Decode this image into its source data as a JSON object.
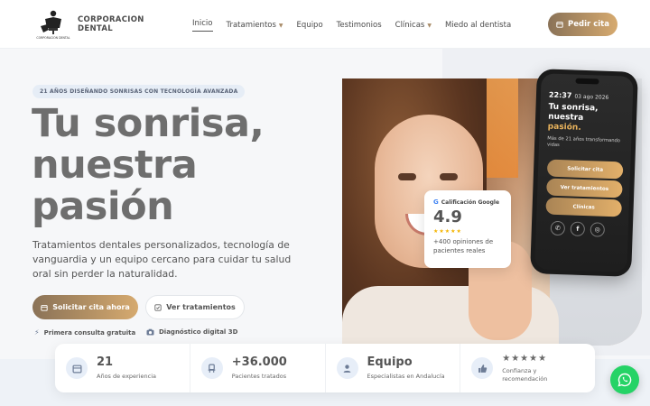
{
  "brand": {
    "logo_line1": "CORPORACION",
    "logo_line2": "DENTAL",
    "logo_tagline": "CORPORACION DENTAL"
  },
  "nav": {
    "items": [
      {
        "label": "Inicio",
        "active": true,
        "dropdown": false
      },
      {
        "label": "Tratamientos",
        "active": false,
        "dropdown": true
      },
      {
        "label": "Equipo",
        "active": false,
        "dropdown": false
      },
      {
        "label": "Testimonios",
        "active": false,
        "dropdown": false
      },
      {
        "label": "Clínicas",
        "active": false,
        "dropdown": true
      },
      {
        "label": "Miedo al dentista",
        "active": false,
        "dropdown": false
      }
    ],
    "cta": "Pedir cita"
  },
  "hero": {
    "eyebrow": "21 AÑOS DISEÑANDO SONRISAS CON TECNOLOGÍA AVANZADA",
    "title_lines": [
      "Tu sonrisa,",
      "nuestra",
      "pasión"
    ],
    "lead": "Tratamientos dentales personalizados, tecnología de vanguardia y un equipo cercano para cuidar tu salud oral sin perder la naturalidad.",
    "primary_button": "Solicitar cita ahora",
    "secondary_button": "Ver tratamientos",
    "features": [
      "Primera consulta gratuita",
      "Diagnóstico digital 3D"
    ]
  },
  "google_card": {
    "title": "Calificación Google",
    "score": "4.9",
    "stars": "★★★★★",
    "reviews": "+400 opiniones de pacientes reales"
  },
  "phone": {
    "time": "22:37",
    "date": "03 ago 2026",
    "headline_lines": [
      "Tu sonrisa,",
      "nuestra",
      "pasión."
    ],
    "subtext": "Más de 21 años transformando vidas",
    "buttons": [
      "Solicitar cita",
      "Ver tratamientos",
      "Clínicas"
    ],
    "social": [
      "whatsapp-icon",
      "facebook-icon",
      "instagram-icon"
    ]
  },
  "stats": [
    {
      "value": "21",
      "label": "Años de experiencia",
      "icon": "calendar-icon"
    },
    {
      "value": "+36.000",
      "label": "Pacientes tratados",
      "icon": "dental-chair-icon"
    },
    {
      "value": "Equipo",
      "label": "Especialistas en Andalucía",
      "icon": "user-icon"
    },
    {
      "value": "★★★★★",
      "label": "Confianza y recomendación",
      "icon": "thumbs-up-icon"
    }
  ],
  "colors": {
    "accent_gradient_start": "#8a7257",
    "accent_gradient_end": "#d6aa6f",
    "whatsapp": "#25d366",
    "title_gray": "#6e6e6e"
  }
}
